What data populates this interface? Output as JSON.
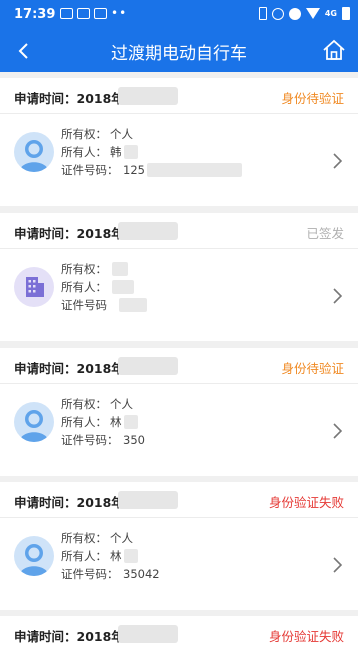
{
  "status_bar": {
    "time": "17:39",
    "network": "4G"
  },
  "header": {
    "title": "过渡期电动自行车",
    "back_icon": "back-arrow-icon",
    "home_icon": "home-icon"
  },
  "colors": {
    "primary": "#1a73e8",
    "pending": "#f08a24",
    "signed": "#b0b0b0",
    "failed": "#e53935"
  },
  "labels": {
    "apply_time": "申请时间：2018年",
    "ownership": "所有权：",
    "owner": "所有人：",
    "id_number": "证件号码：",
    "id_number_short": "证件号码"
  },
  "records": [
    {
      "status": "身份待验证",
      "status_type": "pending",
      "avatar": "person-avatar-icon",
      "ownership": "个人",
      "owner": "韩",
      "id_number": "125"
    },
    {
      "status": "已签发",
      "status_type": "signed",
      "avatar": "building-avatar-icon",
      "ownership": "",
      "owner": "",
      "id_number": ""
    },
    {
      "status": "身份待验证",
      "status_type": "pending",
      "avatar": "person-avatar-icon",
      "ownership": "个人",
      "owner": "林",
      "id_number": "350"
    },
    {
      "status": "身份验证失败",
      "status_type": "failed",
      "avatar": "person-avatar-icon",
      "ownership": "个人",
      "owner": "林",
      "id_number": "35042"
    },
    {
      "status": "身份验证失败",
      "status_type": "failed"
    }
  ]
}
